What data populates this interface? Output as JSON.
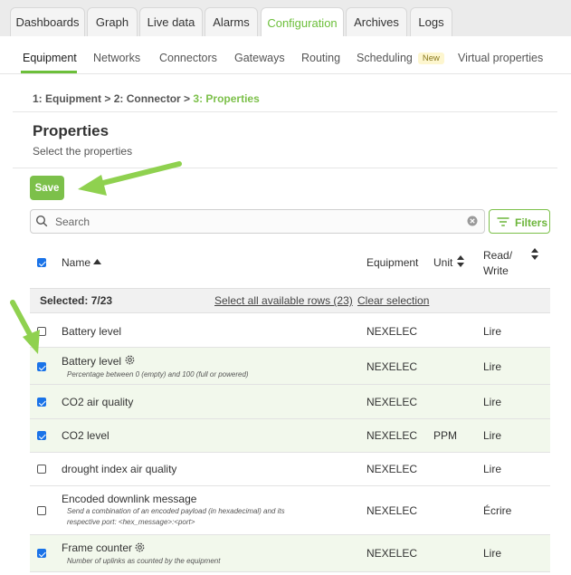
{
  "tabs": [
    {
      "label": "Dashboards",
      "active": false
    },
    {
      "label": "Graph",
      "active": false
    },
    {
      "label": "Live data",
      "active": false
    },
    {
      "label": "Alarms",
      "active": false
    },
    {
      "label": "Configuration",
      "active": true
    },
    {
      "label": "Archives",
      "active": false
    },
    {
      "label": "Logs",
      "active": false
    }
  ],
  "subnav": [
    {
      "label": "Equipment",
      "active": true
    },
    {
      "label": "Networks"
    },
    {
      "label": "Connectors"
    },
    {
      "label": "Gateways"
    },
    {
      "label": "Routing"
    },
    {
      "label": "Scheduling",
      "badge": "New"
    },
    {
      "label": "Virtual properties"
    }
  ],
  "breadcrumb": {
    "step1": "1:  Equipment",
    "sep1": " > ",
    "step2": "2:  Connector",
    "sep2": " > ",
    "step3": "3:  Properties"
  },
  "page": {
    "title": "Properties",
    "subtitle": "Select the properties",
    "save_label": "Save"
  },
  "search": {
    "placeholder": "Search"
  },
  "filters": {
    "label": "Filters"
  },
  "table": {
    "headers": {
      "name": "Name",
      "equipment": "Equipment",
      "unit": "Unit",
      "read_write_line1": "Read/",
      "read_write_line2": "Write"
    },
    "select_all_checked": true,
    "selected_text": "Selected: 7/23",
    "select_all_rows": "Select all available rows (23)",
    "clear_selection": "Clear selection",
    "rows": [
      {
        "name": "Battery level",
        "description": "",
        "equipment": "NEXELEC",
        "unit": "",
        "rw": "Lire",
        "checked": false,
        "gear": false
      },
      {
        "name": "Battery level",
        "description": "Percentage between 0 (empty) and 100 (full or powered)",
        "equipment": "NEXELEC",
        "unit": "",
        "rw": "Lire",
        "checked": true,
        "gear": true
      },
      {
        "name": "CO2 air quality",
        "description": "",
        "equipment": "NEXELEC",
        "unit": "",
        "rw": "Lire",
        "checked": true,
        "gear": false
      },
      {
        "name": "CO2 level",
        "description": "",
        "equipment": "NEXELEC",
        "unit": "PPM",
        "rw": "Lire",
        "checked": true,
        "gear": false
      },
      {
        "name": "drought index air quality",
        "description": "",
        "equipment": "NEXELEC",
        "unit": "",
        "rw": "Lire",
        "checked": false,
        "gear": false
      },
      {
        "name": "Encoded downlink message",
        "description_line1": "Send a combination of an encoded payload (in hexadecimal) and its",
        "description_line2": "respective port: <hex_message>:<port>",
        "equipment": "NEXELEC",
        "unit": "",
        "rw": "Écrire",
        "checked": false,
        "gear": false
      },
      {
        "name": "Frame counter",
        "description": "Number of uplinks as counted by the equipment",
        "equipment": "NEXELEC",
        "unit": "",
        "rw": "Lire",
        "checked": true,
        "gear": true
      }
    ]
  },
  "colors": {
    "accent": "#7cc04a",
    "checkbox": "#1a73e8",
    "selected_row": "#f2f8ec"
  }
}
